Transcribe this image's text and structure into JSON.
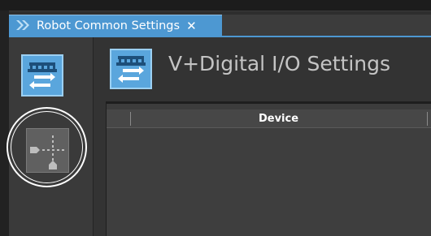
{
  "tab": {
    "label": "Robot Common Settings",
    "close_glyph": "✕",
    "icon": "double-chevron-right-icon",
    "accent": "#4d98d2"
  },
  "sidebar": {
    "items": [
      {
        "icon": "io-transfer-icon",
        "selected": true
      },
      {
        "icon": "io-map-icon",
        "selected": false,
        "highlighted": true
      }
    ]
  },
  "page": {
    "title": "V+Digital I/O Settings",
    "icon": "io-transfer-icon"
  },
  "table": {
    "columns": [
      "",
      "Device"
    ]
  }
}
